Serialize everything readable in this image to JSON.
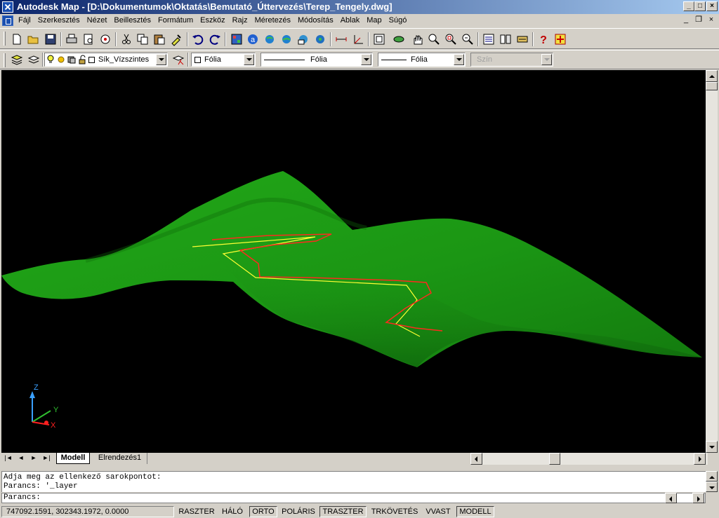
{
  "window": {
    "title": "Autodesk Map - [D:\\Dokumentumok\\Oktatás\\Bemutató_Úttervezés\\Terep_Tengely.dwg]",
    "min_glyph": "_",
    "max_glyph": "□",
    "close_glyph": "×"
  },
  "menu": {
    "items": [
      "Fájl",
      "Szerkesztés",
      "Nézet",
      "Beillesztés",
      "Formátum",
      "Eszköz",
      "Rajz",
      "Méretezés",
      "Módosítás",
      "Ablak",
      "Map",
      "Súgó"
    ],
    "mdi_min": "_",
    "mdi_restore": "❐",
    "mdi_close": "×"
  },
  "standard_toolbar": {
    "icons": [
      "new-icon",
      "open-icon",
      "save-icon",
      "print-icon",
      "print-preview-icon",
      "publish-icon",
      "cut-icon",
      "copy-icon",
      "paste-icon",
      "match-properties-icon",
      "undo-icon",
      "redo-icon",
      "design-center-icon",
      "autodesk-point-a-icon",
      "web-icon",
      "globe-icon",
      "map-icon",
      "map-query-icon",
      "distance-icon",
      "ucs-icon",
      "named-views-icon",
      "3d-orbit-icon",
      "pan-icon",
      "zoom-realtime-icon",
      "zoom-window-icon",
      "zoom-previous-icon",
      "properties-icon",
      "design-center-palette-icon",
      "tool-palette-icon",
      "help-icon",
      "map-help-icon"
    ]
  },
  "layers_toolbar": {
    "layer_name": "Sík_Vízszintes",
    "color_value": "Fólia",
    "linetype_value": "Fólia",
    "lineweight_value": "Fólia",
    "plotstyle_value": "Szín"
  },
  "viewport": {
    "background": "#000000",
    "terrain_color": "#1e9a14",
    "axis_road_colors": {
      "original": "#ffff33",
      "modified": "#ff2a1e"
    },
    "ucs": {
      "z_label": "Z",
      "y_label": "Y",
      "x_label": "X"
    }
  },
  "tabs": {
    "nav_glyphs": [
      "|◄",
      "◄",
      "►",
      "►|"
    ],
    "items": [
      {
        "label": "Modell",
        "active": true
      },
      {
        "label": "Elrendezés1",
        "active": false
      }
    ]
  },
  "command": {
    "history": [
      "Adja meg az ellenkező sarokpontot:",
      "Parancs: '_layer"
    ],
    "prompt": "Parancs:"
  },
  "status": {
    "coordinates": "747092.1591, 302343.1972, 0.0000",
    "buttons": [
      {
        "label": "RASZTER",
        "on": false
      },
      {
        "label": "HÁLÓ",
        "on": false
      },
      {
        "label": "ORTO",
        "on": true
      },
      {
        "label": "POLÁRIS",
        "on": false
      },
      {
        "label": "TRASZTER",
        "on": true
      },
      {
        "label": "TRKÖVETÉS",
        "on": false
      },
      {
        "label": "VVAST",
        "on": false
      },
      {
        "label": "MODELL",
        "on": true
      }
    ]
  }
}
